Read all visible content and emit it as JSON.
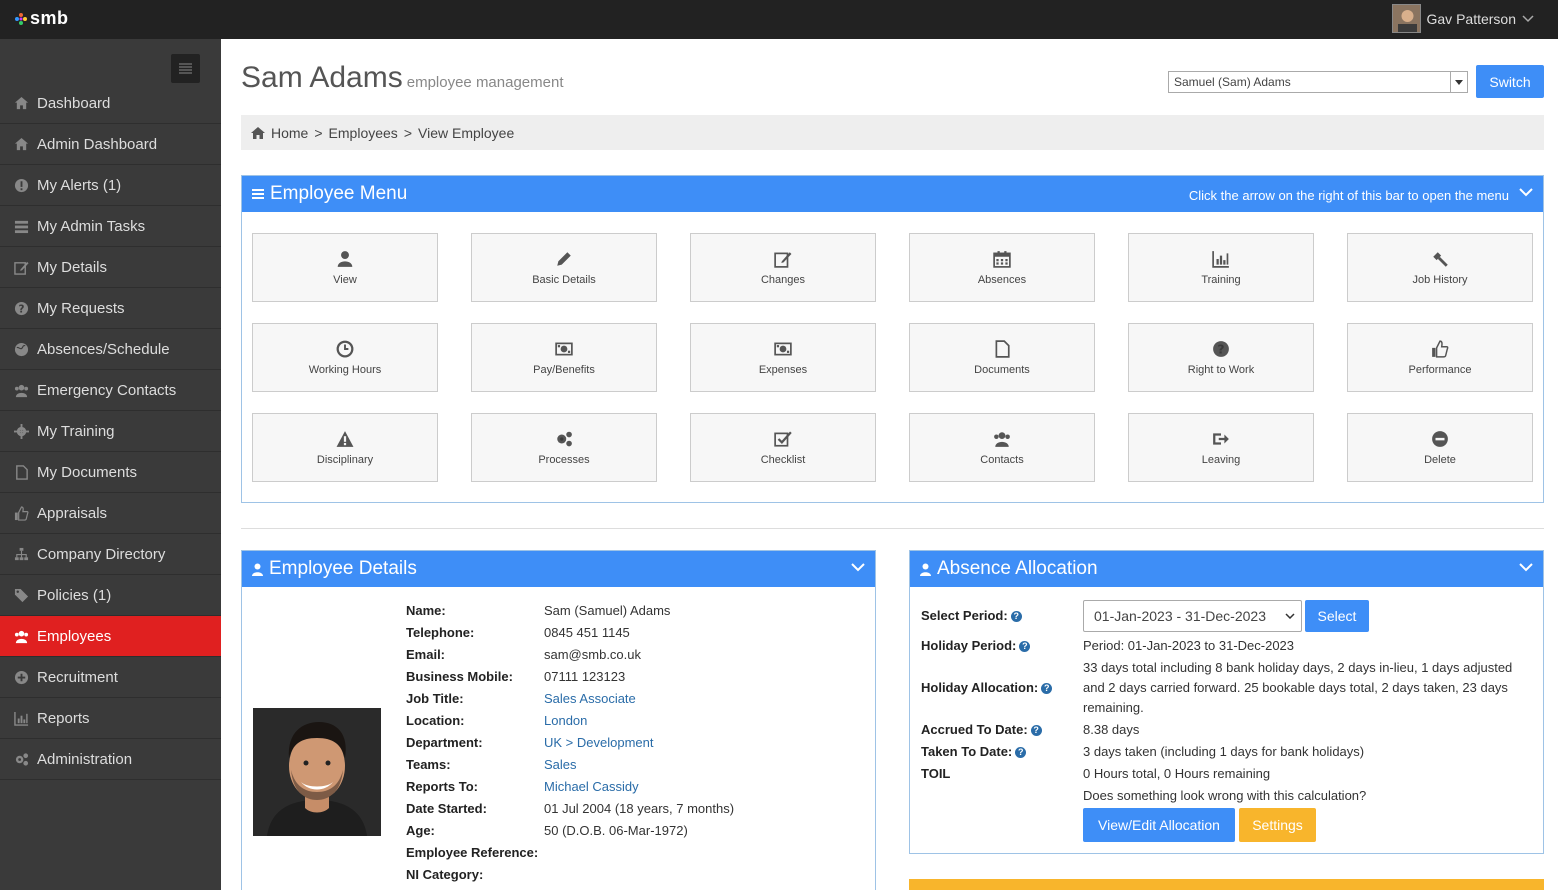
{
  "app": {
    "logo": "smb",
    "user_name": "Gav Patterson"
  },
  "sidebar": {
    "items": [
      {
        "label": "Dashboard",
        "icon": "home-icon"
      },
      {
        "label": "Admin Dashboard",
        "icon": "home-icon"
      },
      {
        "label": "My Alerts (1)",
        "icon": "alert-icon"
      },
      {
        "label": "My Admin Tasks",
        "icon": "tasks-icon"
      },
      {
        "label": "My Details",
        "icon": "edit-icon"
      },
      {
        "label": "My Requests",
        "icon": "question-icon"
      },
      {
        "label": "Absences/Schedule",
        "icon": "globe-icon"
      },
      {
        "label": "Emergency Contacts",
        "icon": "users-icon"
      },
      {
        "label": "My Training",
        "icon": "gear-icon"
      },
      {
        "label": "My Documents",
        "icon": "document-icon"
      },
      {
        "label": "Appraisals",
        "icon": "thumbs-up-icon"
      },
      {
        "label": "Company Directory",
        "icon": "sitemap-icon"
      },
      {
        "label": "Policies (1)",
        "icon": "tags-icon"
      },
      {
        "label": "Employees",
        "icon": "users-icon",
        "active": true
      },
      {
        "label": "Recruitment",
        "icon": "plus-circle-icon"
      },
      {
        "label": "Reports",
        "icon": "bar-chart-icon"
      },
      {
        "label": "Administration",
        "icon": "cogs-icon"
      }
    ]
  },
  "header": {
    "title": "Sam Adams",
    "subtitle": "employee management",
    "employee_select": "Samuel (Sam) Adams",
    "switch_label": "Switch"
  },
  "breadcrumb": {
    "home": "Home",
    "employees": "Employees",
    "current": "View Employee",
    "sep": ">"
  },
  "employee_menu": {
    "title": "Employee Menu",
    "hint": "Click the arrow on the right of this bar to open the menu",
    "tiles": [
      {
        "label": "View",
        "icon": "user-icon"
      },
      {
        "label": "Basic Details",
        "icon": "pencil-icon"
      },
      {
        "label": "Changes",
        "icon": "edit-icon"
      },
      {
        "label": "Absences",
        "icon": "calendar-icon"
      },
      {
        "label": "Training",
        "icon": "bar-chart-icon"
      },
      {
        "label": "Job History",
        "icon": "gavel-icon"
      },
      {
        "label": "Working Hours",
        "icon": "clock-icon"
      },
      {
        "label": "Pay/Benefits",
        "icon": "money-icon"
      },
      {
        "label": "Expenses",
        "icon": "money-icon"
      },
      {
        "label": "Documents",
        "icon": "document-icon"
      },
      {
        "label": "Right to Work",
        "icon": "question-icon"
      },
      {
        "label": "Performance",
        "icon": "thumbs-up-icon"
      },
      {
        "label": "Disciplinary",
        "icon": "warning-icon"
      },
      {
        "label": "Processes",
        "icon": "cogs-icon"
      },
      {
        "label": "Checklist",
        "icon": "checkbox-icon"
      },
      {
        "label": "Contacts",
        "icon": "users-icon"
      },
      {
        "label": "Leaving",
        "icon": "sign-out-icon"
      },
      {
        "label": "Delete",
        "icon": "minus-circle-icon"
      }
    ]
  },
  "employee_details": {
    "title": "Employee Details",
    "rows": [
      {
        "key": "Name:",
        "value": "Sam (Samuel) Adams"
      },
      {
        "key": "Telephone:",
        "value": "0845 451 1145"
      },
      {
        "key": "Email:",
        "value": "sam@smb.co.uk"
      },
      {
        "key": "Business Mobile:",
        "value": "07111 123123"
      },
      {
        "key": "Job Title:",
        "value": "Sales Associate",
        "link": true
      },
      {
        "key": "Location:",
        "value": "London",
        "link": true
      },
      {
        "key": "Department:",
        "value": "UK > Development",
        "link": true
      },
      {
        "key": "Teams:",
        "value": "Sales",
        "link": true
      },
      {
        "key": "Reports To:",
        "value": "Michael Cassidy",
        "link": true
      },
      {
        "key": "Date Started:",
        "value": "01 Jul 2004 (18 years, 7 months)"
      },
      {
        "key": "Age:",
        "value": "50 (D.O.B. 06-Mar-1972)"
      },
      {
        "key": "Employee Reference:",
        "value": ""
      },
      {
        "key": "NI Category:",
        "value": ""
      }
    ]
  },
  "absence_allocation": {
    "title": "Absence Allocation",
    "select_period_label": "Select Period:",
    "period_value": "01-Jan-2023 - 31-Dec-2023",
    "select_button": "Select",
    "holiday_period_label": "Holiday Period:",
    "holiday_period_value": "Period: 01-Jan-2023 to 31-Dec-2023",
    "holiday_allocation_label": "Holiday Allocation:",
    "holiday_allocation_value": "33 days total including 8 bank holiday days, 2 days in-lieu, 1 days adjusted and 2 days carried forward. 25 bookable days total, 2 days taken, 23 days remaining.",
    "accrued_label": "Accrued To Date:",
    "accrued_value": "8.38 days",
    "taken_label": "Taken To Date:",
    "taken_value": "3 days taken (including 1 days for bank holidays)",
    "toil_label": "TOIL",
    "toil_value": "0 Hours total, 0 Hours remaining",
    "wrong_link": "Does something look wrong with this calculation?",
    "view_edit_button": "View/Edit Allocation",
    "settings_button": "Settings"
  },
  "colors": {
    "accent": "#3e8ef7",
    "active_nav": "#e02020",
    "warning": "#f8b52c",
    "topbar": "#222222",
    "sidebar": "#3a3a3a"
  }
}
